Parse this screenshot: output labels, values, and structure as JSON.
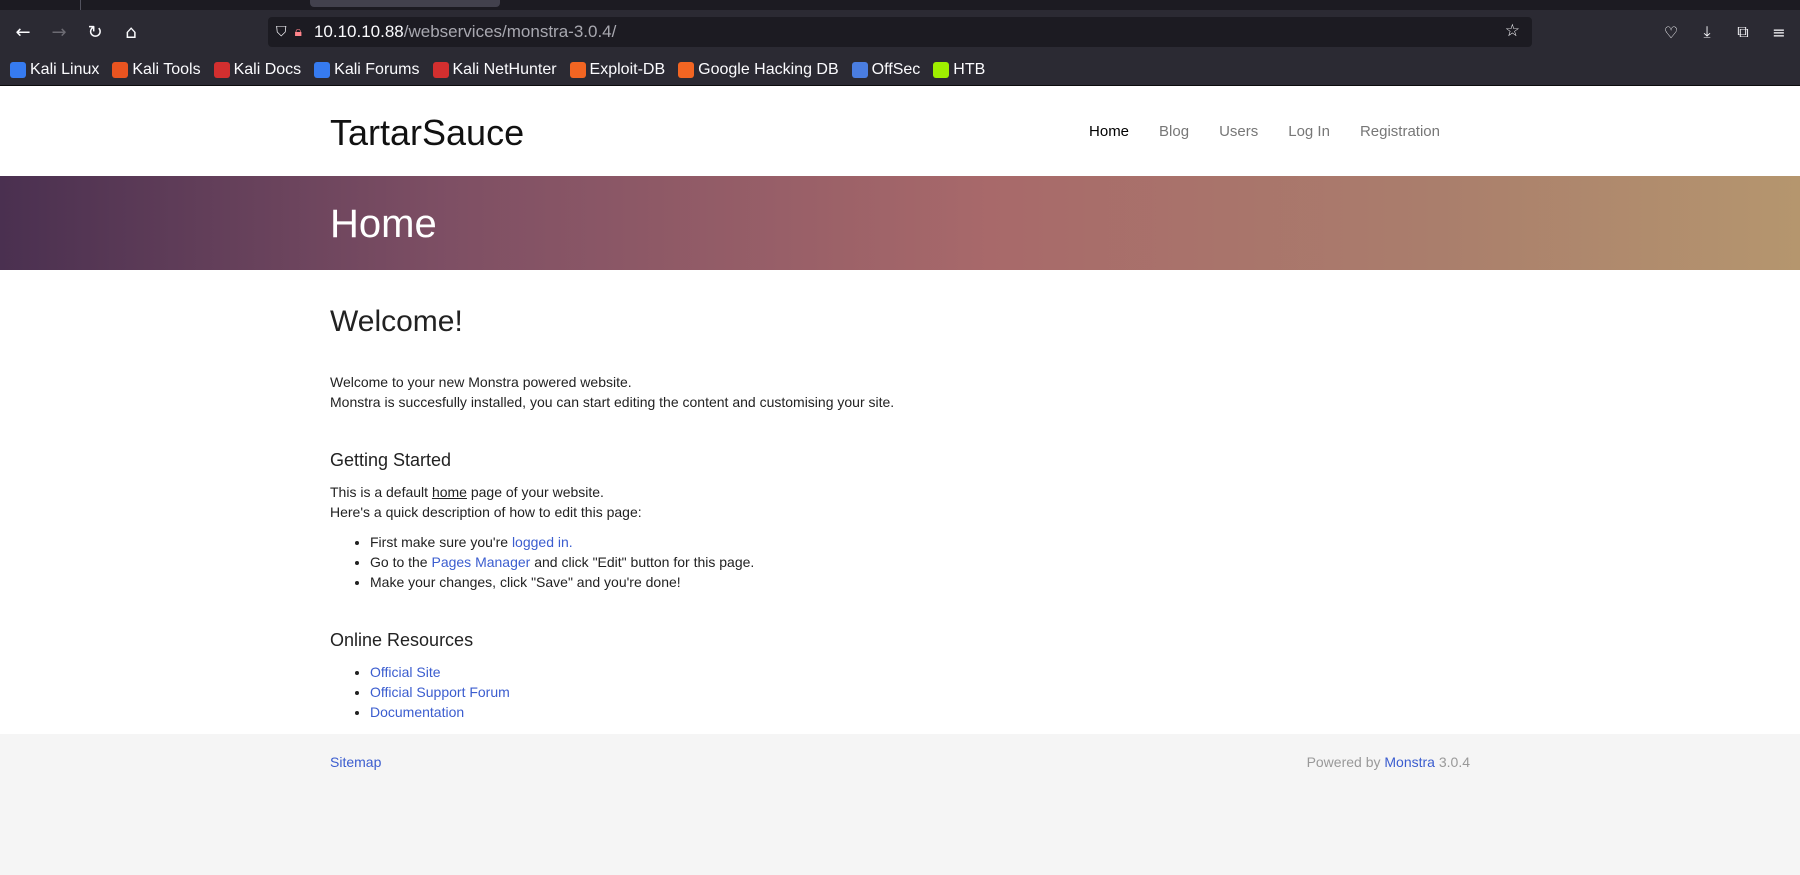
{
  "browser": {
    "url_host": "10.10.10.88",
    "url_path": "/webservices/monstra-3.0.4/",
    "bookmarks": [
      {
        "label": "Kali Linux",
        "color": "#367bf0"
      },
      {
        "label": "Kali Tools",
        "color": "#e95420"
      },
      {
        "label": "Kali Docs",
        "color": "#d32f2f"
      },
      {
        "label": "Kali Forums",
        "color": "#367bf0"
      },
      {
        "label": "Kali NetHunter",
        "color": "#d32f2f"
      },
      {
        "label": "Exploit-DB",
        "color": "#f26522"
      },
      {
        "label": "Google Hacking DB",
        "color": "#f26522"
      },
      {
        "label": "OffSec",
        "color": "#4a7de0"
      },
      {
        "label": "HTB",
        "color": "#9fef00"
      }
    ]
  },
  "site": {
    "brand": "TartarSauce",
    "nav": [
      "Home",
      "Blog",
      "Users",
      "Log In",
      "Registration"
    ],
    "hero_title": "Home"
  },
  "content": {
    "welcome_heading": "Welcome!",
    "welcome_line1": "Welcome to your new Monstra powered website.",
    "welcome_line2": "Monstra is succesfully installed, you can start editing the content and customising your site.",
    "getting_started_heading": "Getting Started",
    "gs_line1_pre": "This is a default ",
    "gs_line1_word": "home",
    "gs_line1_post": " page of your website.",
    "gs_line2": "Here's a quick description of how to edit this page:",
    "step1_pre": "First make sure you're ",
    "step1_link": "logged in.",
    "step2_pre": "Go to the ",
    "step2_link": "Pages Manager",
    "step2_post": " and click \"Edit\" button for this page.",
    "step3": "Make your changes, click \"Save\" and you're done!",
    "resources_heading": "Online Resources",
    "resources": [
      "Official Site",
      "Official Support Forum",
      "Documentation"
    ]
  },
  "footer": {
    "sitemap": "Sitemap",
    "powered_pre": "Powered by ",
    "powered_link": "Monstra",
    "powered_version": " 3.0.4"
  }
}
